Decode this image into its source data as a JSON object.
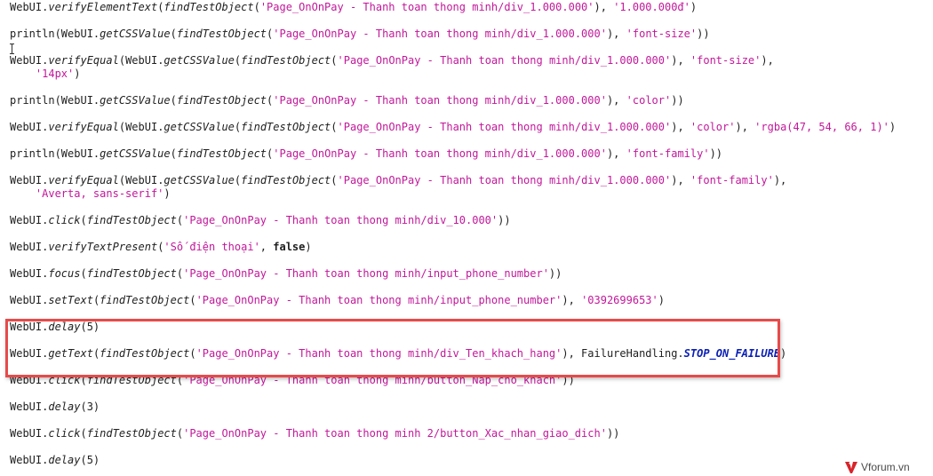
{
  "colors": {
    "string": "#c2189a",
    "constant": "#0a1fb6",
    "text": "#202020",
    "highlight_border": "#e74a4a"
  },
  "lines": [
    [
      [
        "WebUI."
      ],
      [
        "verifyElementText",
        "m"
      ],
      [
        "("
      ],
      [
        "findTestObject",
        "m"
      ],
      [
        "("
      ],
      [
        "'Page_OnOnPay - Thanh toan thong minh/div_1.000.000'",
        "s"
      ],
      [
        "), "
      ],
      [
        "'1.000.000đ'",
        "s"
      ],
      [
        ")"
      ]
    ],
    [
      [
        "println(WebUI."
      ],
      [
        "getCSSValue",
        "m"
      ],
      [
        "("
      ],
      [
        "findTestObject",
        "m"
      ],
      [
        "("
      ],
      [
        "'Page_OnOnPay - Thanh toan thong minh/div_1.000.000'",
        "s"
      ],
      [
        "), "
      ],
      [
        "'font-size'",
        "s"
      ],
      [
        "))"
      ]
    ],
    [
      [
        "WebUI."
      ],
      [
        "verifyEqual",
        "m"
      ],
      [
        "(WebUI."
      ],
      [
        "getCSSValue",
        "m"
      ],
      [
        "("
      ],
      [
        "findTestObject",
        "m"
      ],
      [
        "("
      ],
      [
        "'Page_OnOnPay - Thanh toan thong minh/div_1.000.000'",
        "s"
      ],
      [
        "), "
      ],
      [
        "'font-size'",
        "s"
      ],
      [
        "),"
      ]
    ],
    [
      [
        "    "
      ],
      [
        "'14px'",
        "s"
      ],
      [
        ")"
      ]
    ],
    [
      [
        "println(WebUI."
      ],
      [
        "getCSSValue",
        "m"
      ],
      [
        "("
      ],
      [
        "findTestObject",
        "m"
      ],
      [
        "("
      ],
      [
        "'Page_OnOnPay - Thanh toan thong minh/div_1.000.000'",
        "s"
      ],
      [
        "), "
      ],
      [
        "'color'",
        "s"
      ],
      [
        "))"
      ]
    ],
    [
      [
        "WebUI."
      ],
      [
        "verifyEqual",
        "m"
      ],
      [
        "(WebUI."
      ],
      [
        "getCSSValue",
        "m"
      ],
      [
        "("
      ],
      [
        "findTestObject",
        "m"
      ],
      [
        "("
      ],
      [
        "'Page_OnOnPay - Thanh toan thong minh/div_1.000.000'",
        "s"
      ],
      [
        "), "
      ],
      [
        "'color'",
        "s"
      ],
      [
        "), "
      ],
      [
        "'rgba(47, 54, 66, 1)'",
        "s"
      ],
      [
        ")"
      ]
    ],
    [
      [
        "println(WebUI."
      ],
      [
        "getCSSValue",
        "m"
      ],
      [
        "("
      ],
      [
        "findTestObject",
        "m"
      ],
      [
        "("
      ],
      [
        "'Page_OnOnPay - Thanh toan thong minh/div_1.000.000'",
        "s"
      ],
      [
        "), "
      ],
      [
        "'font-family'",
        "s"
      ],
      [
        "))"
      ]
    ],
    [
      [
        "WebUI."
      ],
      [
        "verifyEqual",
        "m"
      ],
      [
        "(WebUI."
      ],
      [
        "getCSSValue",
        "m"
      ],
      [
        "("
      ],
      [
        "findTestObject",
        "m"
      ],
      [
        "("
      ],
      [
        "'Page_OnOnPay - Thanh toan thong minh/div_1.000.000'",
        "s"
      ],
      [
        "), "
      ],
      [
        "'font-family'",
        "s"
      ],
      [
        "),"
      ]
    ],
    [
      [
        "    "
      ],
      [
        "'Averta, sans-serif'",
        "s"
      ],
      [
        ")"
      ]
    ],
    [
      [
        "WebUI."
      ],
      [
        "click",
        "m"
      ],
      [
        "("
      ],
      [
        "findTestObject",
        "m"
      ],
      [
        "("
      ],
      [
        "'Page_OnOnPay - Thanh toan thong minh/div_10.000'",
        "s"
      ],
      [
        "))"
      ]
    ],
    [
      [
        "WebUI."
      ],
      [
        "verifyTextPresent",
        "m"
      ],
      [
        "("
      ],
      [
        "'Số điện thoại'",
        "s"
      ],
      [
        ", "
      ],
      [
        "false",
        "k"
      ],
      [
        ")"
      ]
    ],
    [
      [
        "WebUI."
      ],
      [
        "focus",
        "m"
      ],
      [
        "("
      ],
      [
        "findTestObject",
        "m"
      ],
      [
        "("
      ],
      [
        "'Page_OnOnPay - Thanh toan thong minh/input_phone_number'",
        "s"
      ],
      [
        "))"
      ]
    ],
    [
      [
        "WebUI."
      ],
      [
        "setText",
        "m"
      ],
      [
        "("
      ],
      [
        "findTestObject",
        "m"
      ],
      [
        "("
      ],
      [
        "'Page_OnOnPay - Thanh toan thong minh/input_phone_number'",
        "s"
      ],
      [
        "), "
      ],
      [
        "'0392699653'",
        "s"
      ],
      [
        ")"
      ]
    ],
    [
      [
        "WebUI."
      ],
      [
        "delay",
        "m"
      ],
      [
        "(5)"
      ]
    ],
    [
      [
        "WebUI."
      ],
      [
        "getText",
        "m"
      ],
      [
        "("
      ],
      [
        "findTestObject",
        "m"
      ],
      [
        "("
      ],
      [
        "'Page_OnOnPay - Thanh toan thong minh/div_Ten_khach_hang'",
        "s"
      ],
      [
        "), FailureHandling."
      ],
      [
        "STOP_ON_FAILURE",
        "c"
      ],
      [
        ")"
      ]
    ],
    [
      [
        "WebUI."
      ],
      [
        "click",
        "m"
      ],
      [
        "("
      ],
      [
        "findTestObject",
        "m"
      ],
      [
        "("
      ],
      [
        "'Page_OnOnPay - Thanh toan thong minh/button_Nap_cho_khach'",
        "s"
      ],
      [
        "))"
      ]
    ],
    [
      [
        "WebUI."
      ],
      [
        "delay",
        "m"
      ],
      [
        "(3)"
      ]
    ],
    [
      [
        "WebUI."
      ],
      [
        "click",
        "m"
      ],
      [
        "("
      ],
      [
        "findTestObject",
        "m"
      ],
      [
        "("
      ],
      [
        "'Page_OnOnPay - Thanh toan thong minh 2/button_Xac_nhan_giao_dich'",
        "s"
      ],
      [
        "))"
      ]
    ],
    [
      [
        "WebUI."
      ],
      [
        "delay",
        "m"
      ],
      [
        "(5)"
      ]
    ]
  ],
  "watermark": {
    "text": "Vforum.vn"
  }
}
